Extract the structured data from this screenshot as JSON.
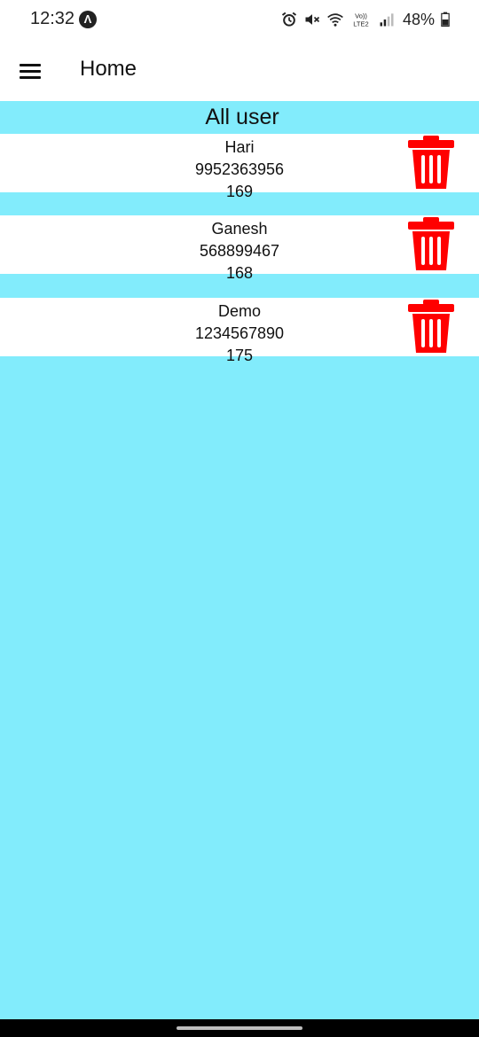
{
  "status_bar": {
    "time": "12:32",
    "nav_badge": "Λ",
    "battery": "48%",
    "icons": [
      "alarm-icon",
      "mute-icon",
      "wifi-icon",
      "volte-icon",
      "signal-icon",
      "battery-icon"
    ],
    "volte_line1": "Vo))",
    "volte_line2": "LTE2"
  },
  "app_bar": {
    "title": "Home",
    "menu_icon": "hamburger-menu-icon"
  },
  "main": {
    "background": "#82ecfc",
    "section_title": "All user",
    "users": [
      {
        "name": "Hari",
        "phone": "9952363956",
        "height": "169"
      },
      {
        "name": "Ganesh",
        "phone": "568899467",
        "height": "168"
      },
      {
        "name": "Demo",
        "phone": "1234567890",
        "height": "175"
      }
    ],
    "delete_icon": "trash-icon",
    "delete_color": "#ff0000"
  }
}
